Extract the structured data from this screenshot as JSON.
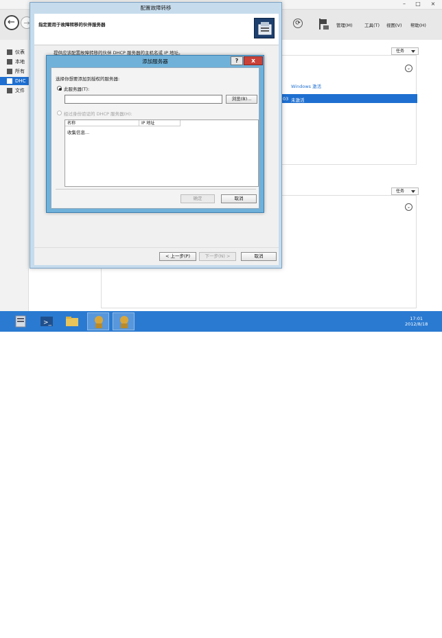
{
  "wizard": {
    "title": "配置故障转移",
    "heading": "指定要用于故障转移的伙伴服务器",
    "description": "提供应该配置故障转移的伙伴 DHCP 服务器的主机名或 IP 地址。",
    "buttons": {
      "back": "< 上一步(P)",
      "next": "下一步(N) >",
      "cancel": "取消"
    }
  },
  "dialog": {
    "title": "添加服务器",
    "help": "?",
    "close": "x",
    "prompt": "选择你想要添加到授权的服务器:",
    "option_this_server": "此服务器(T):",
    "server_input_value": "",
    "browse_label": "浏览(B)...",
    "option_authorized": "经过身份验证的 DHCP 服务器(H):",
    "columns": [
      "名称",
      "IP 地址"
    ],
    "list_status": "收集信息...",
    "buttons": {
      "ok": "确定",
      "cancel": "取消"
    }
  },
  "server_manager": {
    "menu": [
      "管理(M)",
      "工具(T)",
      "视图(V)",
      "帮助(H)"
    ],
    "sidebar": [
      "仪表",
      "本地",
      "所有",
      "DHC",
      "文件"
    ],
    "tasks_label": "任务",
    "windows_activation": "Windows 激活",
    "not_activated": "未激活",
    "row_prefix": "03"
  },
  "taskbar": {
    "time": "17:01",
    "date": "2012/8/18"
  },
  "colors": {
    "accent": "#1e6fd0",
    "dialog_frame": "#6fb1d9",
    "wizard_frame": "#c6dced",
    "taskbar": "#2a7ad1",
    "close_button": "#c9423a"
  }
}
